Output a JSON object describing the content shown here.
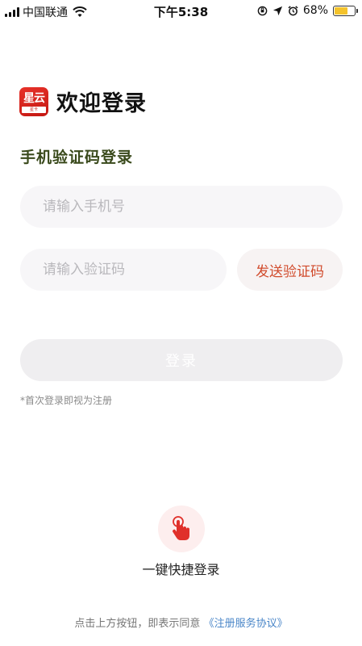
{
  "status_bar": {
    "carrier": "中国联通",
    "time": "下午5:38",
    "battery": "68%",
    "battery_level": 0.68,
    "icons": [
      "signal-icon",
      "wifi-icon",
      "orientation-lock-icon",
      "location-icon",
      "alarm-icon",
      "battery-icon"
    ]
  },
  "header": {
    "logo_text": "星云",
    "logo_band_text": "星卡",
    "title": "欢迎登录"
  },
  "form": {
    "subtitle": "手机验证码登录",
    "phone_placeholder": "请输入手机号",
    "code_placeholder": "请输入验证码",
    "send_code_label": "发送验证码",
    "login_label": "登录",
    "note": "*首次登录即视为注册"
  },
  "quick_login": {
    "label": "一键快捷登录",
    "icon": "tap-hand-icon"
  },
  "agreement": {
    "prefix": "点击上方按钮，即表示同意",
    "link": "《注册服务协议》"
  },
  "colors": {
    "accent": "#d14b2c",
    "link": "#4a86c8",
    "subtitle": "#3a4a1c",
    "battery": "#f4c32c"
  }
}
